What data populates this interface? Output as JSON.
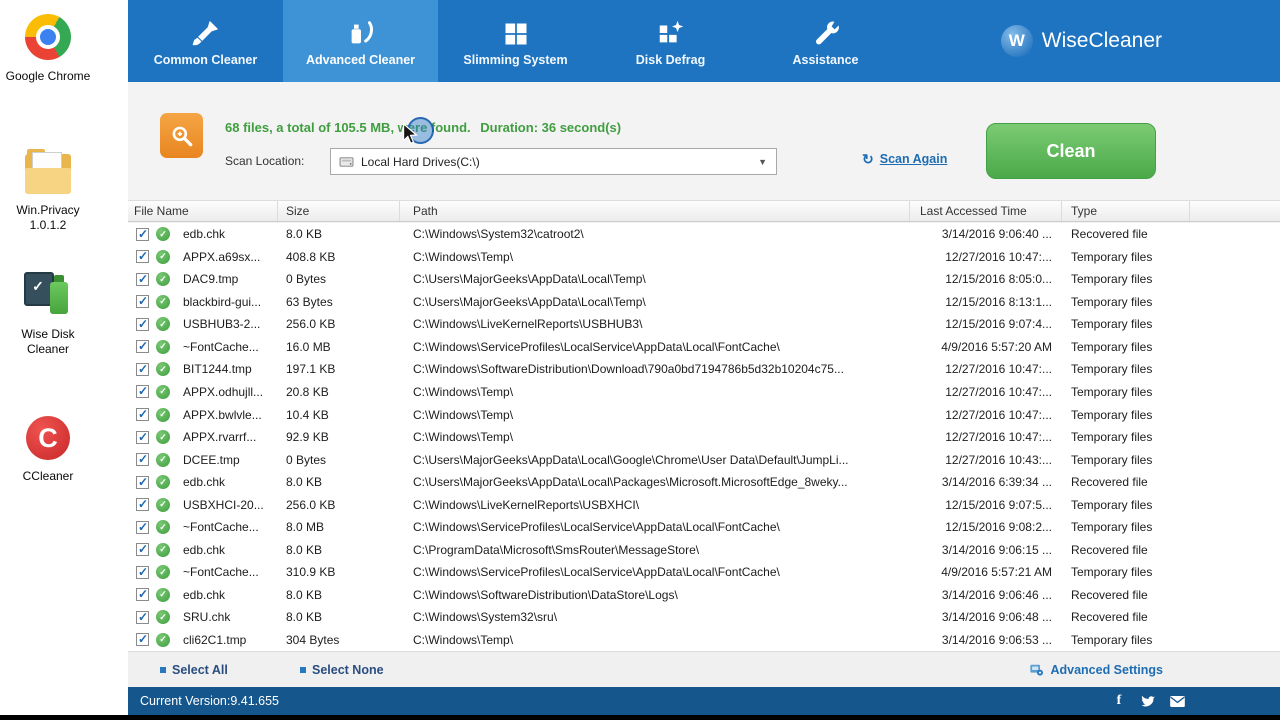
{
  "desktop": {
    "icons": [
      {
        "name": "google-chrome",
        "label": "Google Chrome"
      },
      {
        "name": "win-privacy",
        "label": "Win.Privacy 1.0.1.2"
      },
      {
        "name": "wise-disk-cleaner",
        "label": "Wise Disk Cleaner"
      },
      {
        "name": "ccleaner",
        "label": "CCleaner"
      }
    ]
  },
  "app": {
    "brand": "WiseCleaner",
    "brand_initial": "W",
    "tabs": [
      {
        "label": "Common Cleaner",
        "icon": "brush-icon",
        "active": false
      },
      {
        "label": "Advanced Cleaner",
        "icon": "spray-swoosh-icon",
        "active": true
      },
      {
        "label": "Slimming System",
        "icon": "window-panes-icon",
        "active": false
      },
      {
        "label": "Disk Defrag",
        "icon": "defrag-blocks-icon",
        "active": false
      },
      {
        "label": "Assistance",
        "icon": "wrench-icon",
        "active": false
      }
    ]
  },
  "summary": {
    "result_text": "68 files, a total of 105.5 MB, were found.",
    "duration_text": "Duration: 36 second(s)",
    "scan_location_label": "Scan Location:",
    "scan_location_value": "Local Hard Drives(C:\\)",
    "scan_again_label": "Scan Again",
    "clean_label": "Clean"
  },
  "table": {
    "headers": [
      "File Name",
      "Size",
      "Path",
      "Last Accessed Time",
      "Type"
    ],
    "rows": [
      {
        "checked": true,
        "name": "edb.chk",
        "size": "8.0 KB",
        "path": "C:\\Windows\\System32\\catroot2\\",
        "time": "3/14/2016 9:06:40 ...",
        "type": "Recovered file"
      },
      {
        "checked": true,
        "name": "APPX.a69sx...",
        "size": "408.8 KB",
        "path": "C:\\Windows\\Temp\\",
        "time": "12/27/2016 10:47:...",
        "type": "Temporary files"
      },
      {
        "checked": true,
        "name": "DAC9.tmp",
        "size": "0 Bytes",
        "path": "C:\\Users\\MajorGeeks\\AppData\\Local\\Temp\\",
        "time": "12/15/2016 8:05:0...",
        "type": "Temporary files"
      },
      {
        "checked": true,
        "name": "blackbird-gui...",
        "size": "63 Bytes",
        "path": "C:\\Users\\MajorGeeks\\AppData\\Local\\Temp\\",
        "time": "12/15/2016 8:13:1...",
        "type": "Temporary files"
      },
      {
        "checked": true,
        "name": "USBHUB3-2...",
        "size": "256.0 KB",
        "path": "C:\\Windows\\LiveKernelReports\\USBHUB3\\",
        "time": "12/15/2016 9:07:4...",
        "type": "Temporary files"
      },
      {
        "checked": true,
        "name": "~FontCache...",
        "size": "16.0 MB",
        "path": "C:\\Windows\\ServiceProfiles\\LocalService\\AppData\\Local\\FontCache\\",
        "time": "4/9/2016 5:57:20 AM",
        "type": "Temporary files"
      },
      {
        "checked": true,
        "name": "BIT1244.tmp",
        "size": "197.1 KB",
        "path": "C:\\Windows\\SoftwareDistribution\\Download\\790a0bd7194786b5d32b10204c75...",
        "time": "12/27/2016 10:47:...",
        "type": "Temporary files"
      },
      {
        "checked": true,
        "name": "APPX.odhujll...",
        "size": "20.8 KB",
        "path": "C:\\Windows\\Temp\\",
        "time": "12/27/2016 10:47:...",
        "type": "Temporary files"
      },
      {
        "checked": true,
        "name": "APPX.bwlvle...",
        "size": "10.4 KB",
        "path": "C:\\Windows\\Temp\\",
        "time": "12/27/2016 10:47:...",
        "type": "Temporary files"
      },
      {
        "checked": true,
        "name": "APPX.rvarrf...",
        "size": "92.9 KB",
        "path": "C:\\Windows\\Temp\\",
        "time": "12/27/2016 10:47:...",
        "type": "Temporary files"
      },
      {
        "checked": true,
        "name": "DCEE.tmp",
        "size": "0 Bytes",
        "path": "C:\\Users\\MajorGeeks\\AppData\\Local\\Google\\Chrome\\User Data\\Default\\JumpLi...",
        "time": "12/27/2016 10:43:...",
        "type": "Temporary files"
      },
      {
        "checked": true,
        "name": "edb.chk",
        "size": "8.0 KB",
        "path": "C:\\Users\\MajorGeeks\\AppData\\Local\\Packages\\Microsoft.MicrosoftEdge_8weky...",
        "time": "3/14/2016 6:39:34 ...",
        "type": "Recovered file"
      },
      {
        "checked": true,
        "name": "USBXHCI-20...",
        "size": "256.0 KB",
        "path": "C:\\Windows\\LiveKernelReports\\USBXHCI\\",
        "time": "12/15/2016 9:07:5...",
        "type": "Temporary files"
      },
      {
        "checked": true,
        "name": "~FontCache...",
        "size": "8.0 MB",
        "path": "C:\\Windows\\ServiceProfiles\\LocalService\\AppData\\Local\\FontCache\\",
        "time": "12/15/2016 9:08:2...",
        "type": "Temporary files"
      },
      {
        "checked": true,
        "name": "edb.chk",
        "size": "8.0 KB",
        "path": "C:\\ProgramData\\Microsoft\\SmsRouter\\MessageStore\\",
        "time": "3/14/2016 9:06:15 ...",
        "type": "Recovered file"
      },
      {
        "checked": true,
        "name": "~FontCache...",
        "size": "310.9 KB",
        "path": "C:\\Windows\\ServiceProfiles\\LocalService\\AppData\\Local\\FontCache\\",
        "time": "4/9/2016 5:57:21 AM",
        "type": "Temporary files"
      },
      {
        "checked": true,
        "name": "edb.chk",
        "size": "8.0 KB",
        "path": "C:\\Windows\\SoftwareDistribution\\DataStore\\Logs\\",
        "time": "3/14/2016 9:06:46 ...",
        "type": "Recovered file"
      },
      {
        "checked": true,
        "name": "SRU.chk",
        "size": "8.0 KB",
        "path": "C:\\Windows\\System32\\sru\\",
        "time": "3/14/2016 9:06:48 ...",
        "type": "Recovered file"
      },
      {
        "checked": true,
        "name": "cli62C1.tmp",
        "size": "304 Bytes",
        "path": "C:\\Windows\\Temp\\",
        "time": "3/14/2016 9:06:53 ...",
        "type": "Temporary files"
      }
    ]
  },
  "footer": {
    "select_all": "Select All",
    "select_none": "Select None",
    "advanced_settings": "Advanced Settings"
  },
  "statusbar": {
    "version": "Current Version:9.41.655"
  },
  "icons": {
    "ccleaner_glyph": "C",
    "checkbox_check": "✓",
    "status_check": "✓",
    "dropdown_caret": "▼",
    "refresh": "↻"
  },
  "colors": {
    "header_blue": "#1e74c0",
    "active_tab_blue": "#3e92d6",
    "accent_green": "#3f9e3f",
    "clean_button_green": "#4aa948",
    "link_blue": "#1e6db3",
    "statusbar_blue": "#15568d",
    "scan_badge_orange": "#ef9232"
  }
}
